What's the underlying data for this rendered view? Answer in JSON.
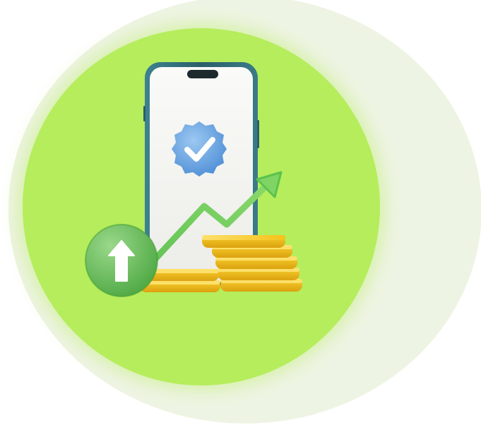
{
  "colors": {
    "background": "#ffffff",
    "outer_circle": "#eef4e3",
    "feature_circle": "#b5ed5c",
    "phone_frame": "#2f6b78",
    "phone_screen": "#f4f4f2",
    "badge": "#6ba9e6",
    "arrow": "#5cc24d",
    "coin": "#f5c21b",
    "up_button": "#6bc05e"
  },
  "illustration": {
    "phone": {
      "icon": "smartphone-icon"
    },
    "badge": {
      "icon": "verified-check-badge-icon"
    },
    "trend_arrow": {
      "icon": "growth-trend-arrow-icon"
    },
    "coins": {
      "icon": "coin-stack-icon"
    },
    "up_button": {
      "icon": "arrow-up-circle-icon"
    }
  }
}
